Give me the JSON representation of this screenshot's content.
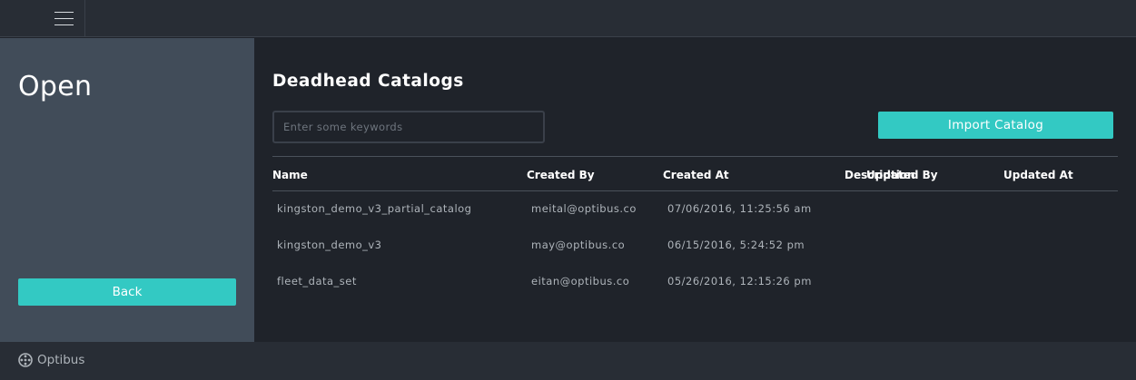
{
  "header": {
    "menu_icon": "hamburger-menu-icon"
  },
  "sidebar": {
    "title": "Open",
    "back_label": "Back"
  },
  "main": {
    "title": "Deadhead Catalogs",
    "search": {
      "placeholder": "Enter some keywords",
      "value": ""
    },
    "import_label": "Import Catalog"
  },
  "table": {
    "columns": [
      "Name",
      "Created By",
      "Created At",
      "Description",
      "Updated By",
      "Updated At"
    ],
    "rows": [
      {
        "name": "kingston_demo_v3_partial_catalog",
        "created_by": "meital@optibus.co",
        "created_at": "07/06/2016, 11:25:56 am",
        "description": "",
        "updated_by": "",
        "updated_at": ""
      },
      {
        "name": "kingston_demo_v3",
        "created_by": "may@optibus.co",
        "created_at": "06/15/2016, 5:24:52 pm",
        "description": "",
        "updated_by": "",
        "updated_at": ""
      },
      {
        "name": "fleet_data_set",
        "created_by": "eitan@optibus.co",
        "created_at": "05/26/2016, 12:15:26 pm",
        "description": "",
        "updated_by": "",
        "updated_at": ""
      }
    ]
  },
  "footer": {
    "logo_text": "Optibus",
    "logo_icon": "optibus-logo-icon"
  },
  "colors": {
    "accent": "#33c9c3",
    "sidebar_bg": "#414c59",
    "main_bg": "#1f232a",
    "bar_bg": "#282d35"
  }
}
